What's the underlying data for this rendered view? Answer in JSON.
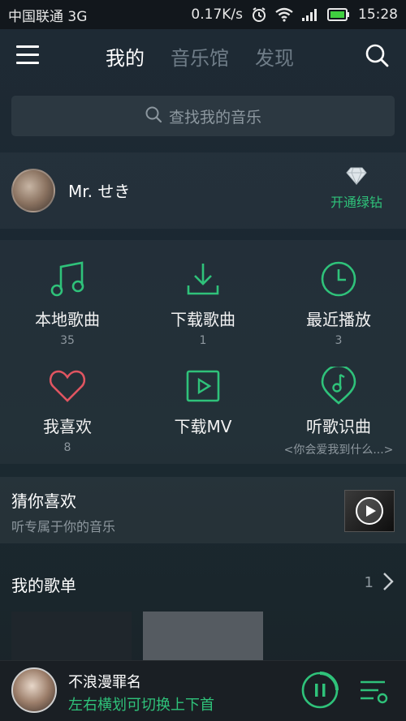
{
  "status_bar": {
    "carrier": "中国联通 3G",
    "speed": "0.17K/s",
    "time": "15:28",
    "icons": [
      "alarm-icon",
      "wifi-icon",
      "signal-icon",
      "battery-icon"
    ]
  },
  "nav": {
    "tabs": [
      {
        "label": "我的",
        "active": true
      },
      {
        "label": "音乐馆",
        "active": false
      },
      {
        "label": "发现",
        "active": false
      }
    ]
  },
  "search": {
    "placeholder": "查找我的音乐"
  },
  "profile": {
    "username": "Mr. せき",
    "vip_label": "开通绿钻"
  },
  "grid": {
    "items": [
      {
        "label": "本地歌曲",
        "sub": "35",
        "icon": "music-note-icon"
      },
      {
        "label": "下载歌曲",
        "sub": "1",
        "icon": "download-icon"
      },
      {
        "label": "最近播放",
        "sub": "3",
        "icon": "clock-icon"
      },
      {
        "label": "我喜欢",
        "sub": "8",
        "icon": "heart-icon"
      },
      {
        "label": "下载MV",
        "sub": "",
        "icon": "video-play-icon"
      },
      {
        "label": "听歌识曲",
        "sub": "<你会爱我到什么...>",
        "icon": "song-recognition-icon"
      }
    ]
  },
  "guess": {
    "title": "猜你喜欢",
    "subtitle": "听专属于你的音乐"
  },
  "playlists": {
    "title": "我的歌单",
    "count": "1"
  },
  "player": {
    "song_title": "不浪漫罪名",
    "hint": "左右横划可切换上下首"
  },
  "colors": {
    "accent": "#2fc27a",
    "heart": "#e05561"
  }
}
